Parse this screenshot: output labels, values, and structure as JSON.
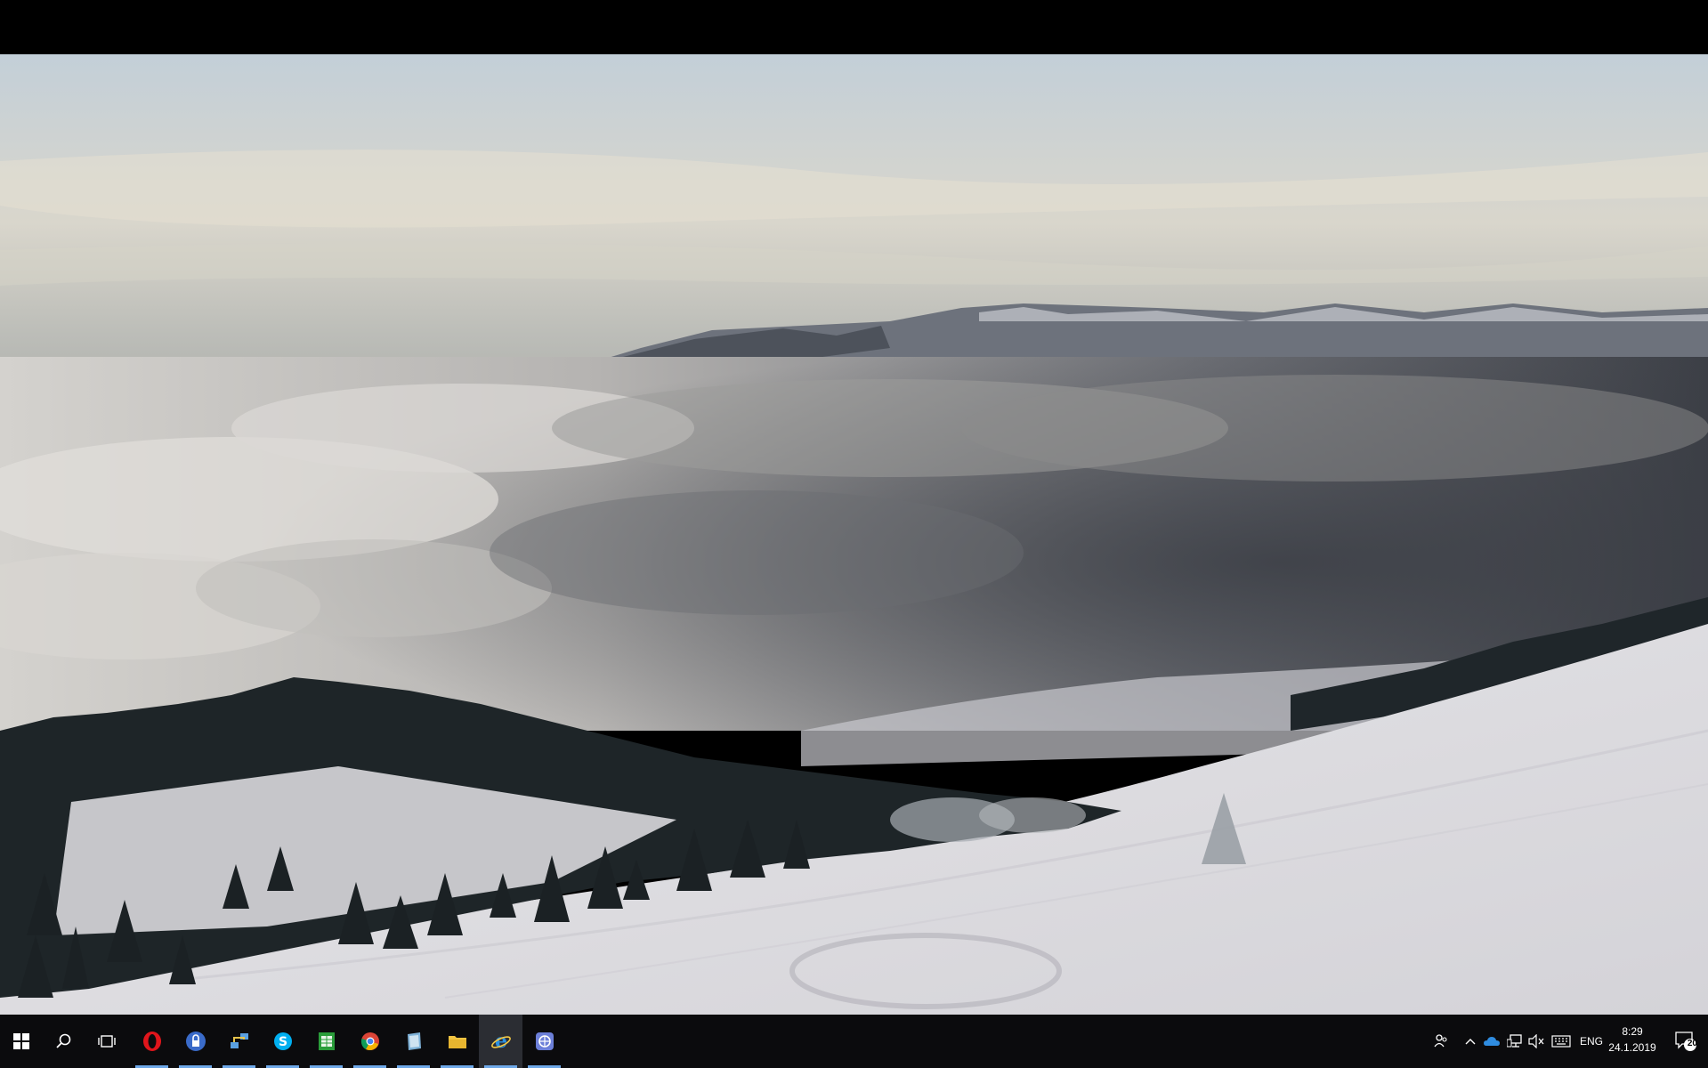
{
  "desktop": {
    "wallpaper": "winter-mountain-fog-landscape",
    "colors": {
      "sky_top": "#c9d3da",
      "sky_mid": "#d9d8d0",
      "horizon": "#b8b8b0",
      "fog_light": "#d8d6d3",
      "fog_dark": "#4a4d54",
      "snow": "#e9e8ea",
      "trees": "#1d2326"
    }
  },
  "taskbar": {
    "start_icon": "windows-logo-icon",
    "search_icon": "search-icon",
    "task_view_icon": "task-view-icon",
    "apps": [
      {
        "name": "opera",
        "icon": "opera-icon",
        "color": "#e0151b"
      },
      {
        "name": "security",
        "icon": "lock-shield-icon",
        "color": "#3a6bc9"
      },
      {
        "name": "network",
        "icon": "network-icon",
        "color": "#5aa0e0"
      },
      {
        "name": "skype",
        "icon": "skype-icon",
        "color": "#00aff0"
      },
      {
        "name": "spreadsheet",
        "icon": "spreadsheet-icon",
        "color": "#2a9d3a"
      },
      {
        "name": "chrome",
        "icon": "chrome-icon",
        "color": "#db4437"
      },
      {
        "name": "notes",
        "icon": "notes-icon",
        "color": "#7fb2d8"
      },
      {
        "name": "file-explorer",
        "icon": "folder-icon",
        "color": "#f4c542"
      },
      {
        "name": "internet-explorer",
        "icon": "internet-explorer-icon",
        "color": "#2b8fe0"
      },
      {
        "name": "vpn",
        "icon": "vpn-icon",
        "color": "#6c7fd8"
      }
    ],
    "tray": {
      "people_icon": "people-icon",
      "chevron_icon": "chevron-up-icon",
      "onedrive_icon": "onedrive-icon",
      "network_icon": "network-monitor-icon",
      "volume_icon": "volume-muted-icon",
      "keyboard_icon": "keyboard-icon",
      "language": "ENG",
      "time": "8:29",
      "date": "24.1.2019",
      "notification_count": "20",
      "notification_icon": "notification-icon"
    }
  }
}
